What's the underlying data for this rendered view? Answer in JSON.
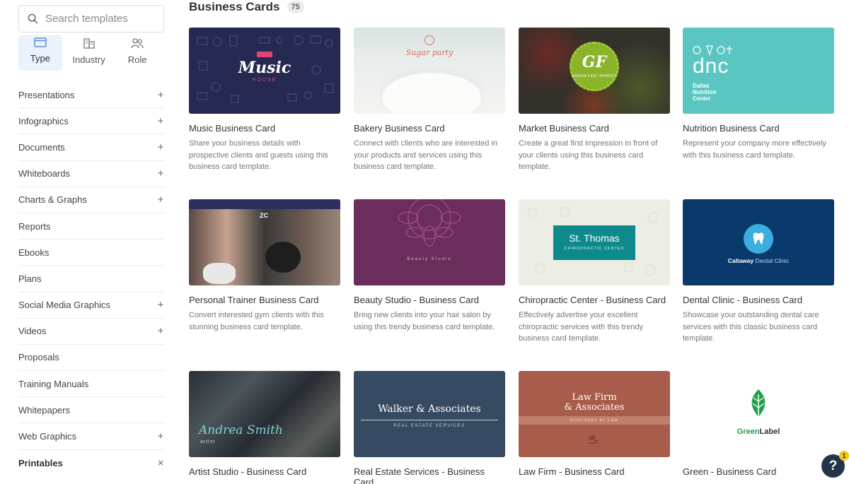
{
  "sidebar": {
    "search_placeholder": "Search templates",
    "filters": [
      {
        "label": "Type",
        "icon": "type-icon"
      },
      {
        "label": "Industry",
        "icon": "industry-icon"
      },
      {
        "label": "Role",
        "icon": "role-icon"
      }
    ],
    "nav": [
      {
        "label": "Presentations",
        "icon": "+"
      },
      {
        "label": "Infographics",
        "icon": "+"
      },
      {
        "label": "Documents",
        "icon": "+"
      },
      {
        "label": "Whiteboards",
        "icon": "+"
      },
      {
        "label": "Charts & Graphs",
        "icon": "+"
      },
      {
        "label": "Reports",
        "icon": ""
      },
      {
        "label": "Ebooks",
        "icon": ""
      },
      {
        "label": "Plans",
        "icon": ""
      },
      {
        "label": "Social Media Graphics",
        "icon": "+"
      },
      {
        "label": "Videos",
        "icon": "+"
      },
      {
        "label": "Proposals",
        "icon": ""
      },
      {
        "label": "Training Manuals",
        "icon": ""
      },
      {
        "label": "Whitepapers",
        "icon": ""
      },
      {
        "label": "Web Graphics",
        "icon": "+"
      },
      {
        "label": "Printables",
        "icon": "×"
      }
    ]
  },
  "main": {
    "title": "Business Cards",
    "count": "75",
    "cards": [
      {
        "title": "Music Business Card",
        "desc": "Share your business details with prospective clients and guests using this business card template.",
        "thumb": {
          "text": "Music",
          "sub": "HOUSE"
        }
      },
      {
        "title": "Bakery Business Card",
        "desc": "Connect with clients who are interested in your products and services using this business card template.",
        "thumb": {
          "text": "Sugar party"
        }
      },
      {
        "title": "Market Business Card",
        "desc": "Create a great first impression in front of your clients using this business card template.",
        "thumb": {
          "text": "GF",
          "sub": "GREEN FEEL MARKET"
        }
      },
      {
        "title": "Nutrition Business Card",
        "desc": "Represent your company more effectively with this business card template.",
        "thumb": {
          "text": "dnc",
          "sub": "Dallas Nutrition Center"
        }
      },
      {
        "title": "Personal Trainer Business Card",
        "desc": "Convert interested gym clients with this stunning business card template.",
        "thumb": {
          "text": "ZC"
        }
      },
      {
        "title": "Beauty Studio - Business Card",
        "desc": "Bring new clients into your hair salon by using this trendy business card template.",
        "thumb": {
          "text": "Beauty Studio"
        }
      },
      {
        "title": "Chiropractic Center - Business Card",
        "desc": "Effectively advertise your excellent chiropractic services with this trendy business card template.",
        "thumb": {
          "text": "St. Thomas",
          "sub": "CHIROPRACTIC CENTER"
        }
      },
      {
        "title": "Dental Clinic - Business Card",
        "desc": "Showcase your outstanding dental care services with this classic business card template.",
        "thumb": {
          "text": "Callaway",
          "sub": "Dental Clinic"
        }
      },
      {
        "title": "Artist Studio - Business Card",
        "desc": "",
        "thumb": {
          "text": "Andrea Smith",
          "sub": "artist"
        }
      },
      {
        "title": "Real Estate Services - Business Card",
        "desc": "",
        "thumb": {
          "text": "Walker & Associates",
          "sub": "REAL ESTATE SERVICES"
        }
      },
      {
        "title": "Law Firm - Business Card",
        "desc": "",
        "thumb": {
          "text": "Law Firm",
          "text2": "& Associates",
          "sub": "Attorneys at Law"
        }
      },
      {
        "title": "Green - Business Card",
        "desc": "",
        "thumb": {
          "text": "Green",
          "text2": "Label"
        }
      }
    ]
  },
  "help": {
    "label": "?",
    "badge": "1"
  }
}
